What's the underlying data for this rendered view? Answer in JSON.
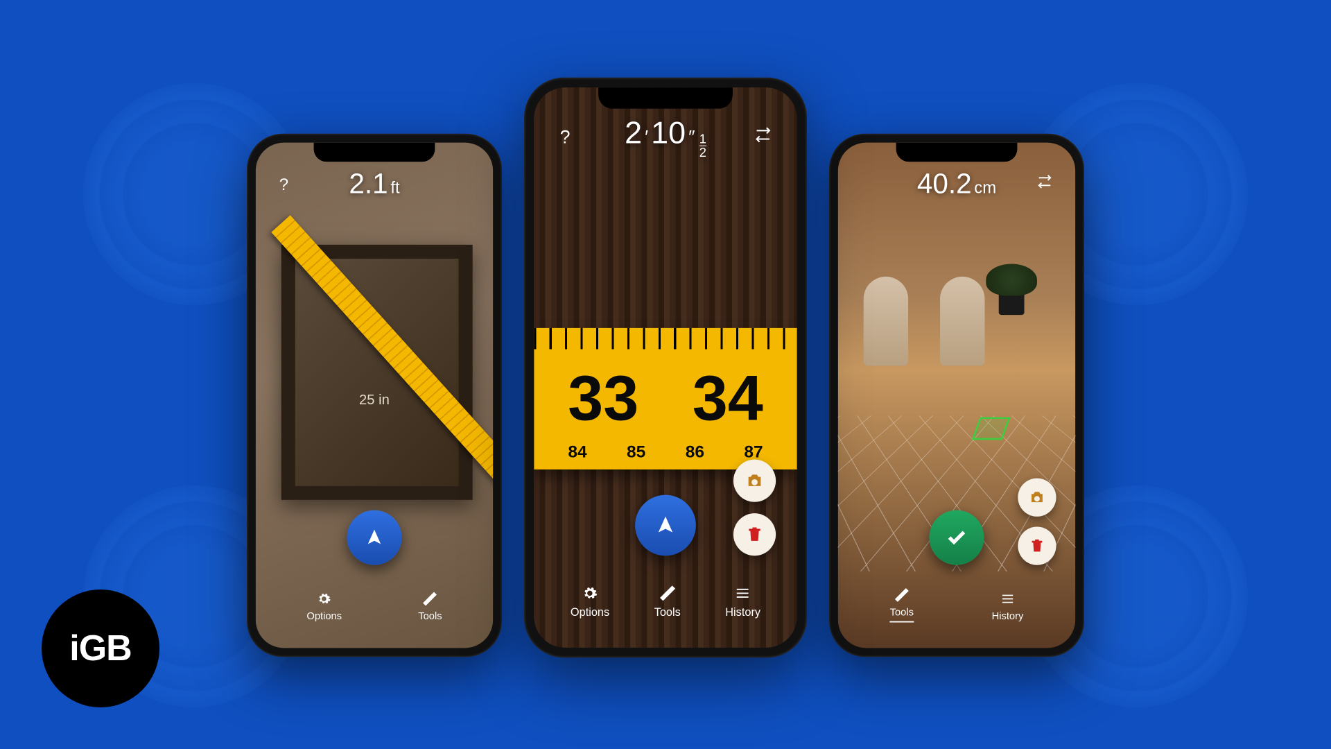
{
  "badge": {
    "text": "iGB"
  },
  "phones": {
    "left": {
      "help": "?",
      "measurement": {
        "value": "2.1",
        "unit": "ft"
      },
      "tapeLabel": "25 in",
      "nav": {
        "options": "Options",
        "tools": "Tools"
      }
    },
    "center": {
      "help": "?",
      "measurement": {
        "feet": "2",
        "inches": "10",
        "fracTop": "1",
        "fracBot": "2"
      },
      "ruler": {
        "big1": "33",
        "big2": "34",
        "s1": "84",
        "s2": "85",
        "s3": "86",
        "s4": "87"
      },
      "nav": {
        "options": "Options",
        "tools": "Tools",
        "history": "History"
      }
    },
    "right": {
      "measurement": {
        "value": "40.2",
        "unit": "cm"
      },
      "nav": {
        "tools": "Tools",
        "history": "History"
      }
    }
  }
}
